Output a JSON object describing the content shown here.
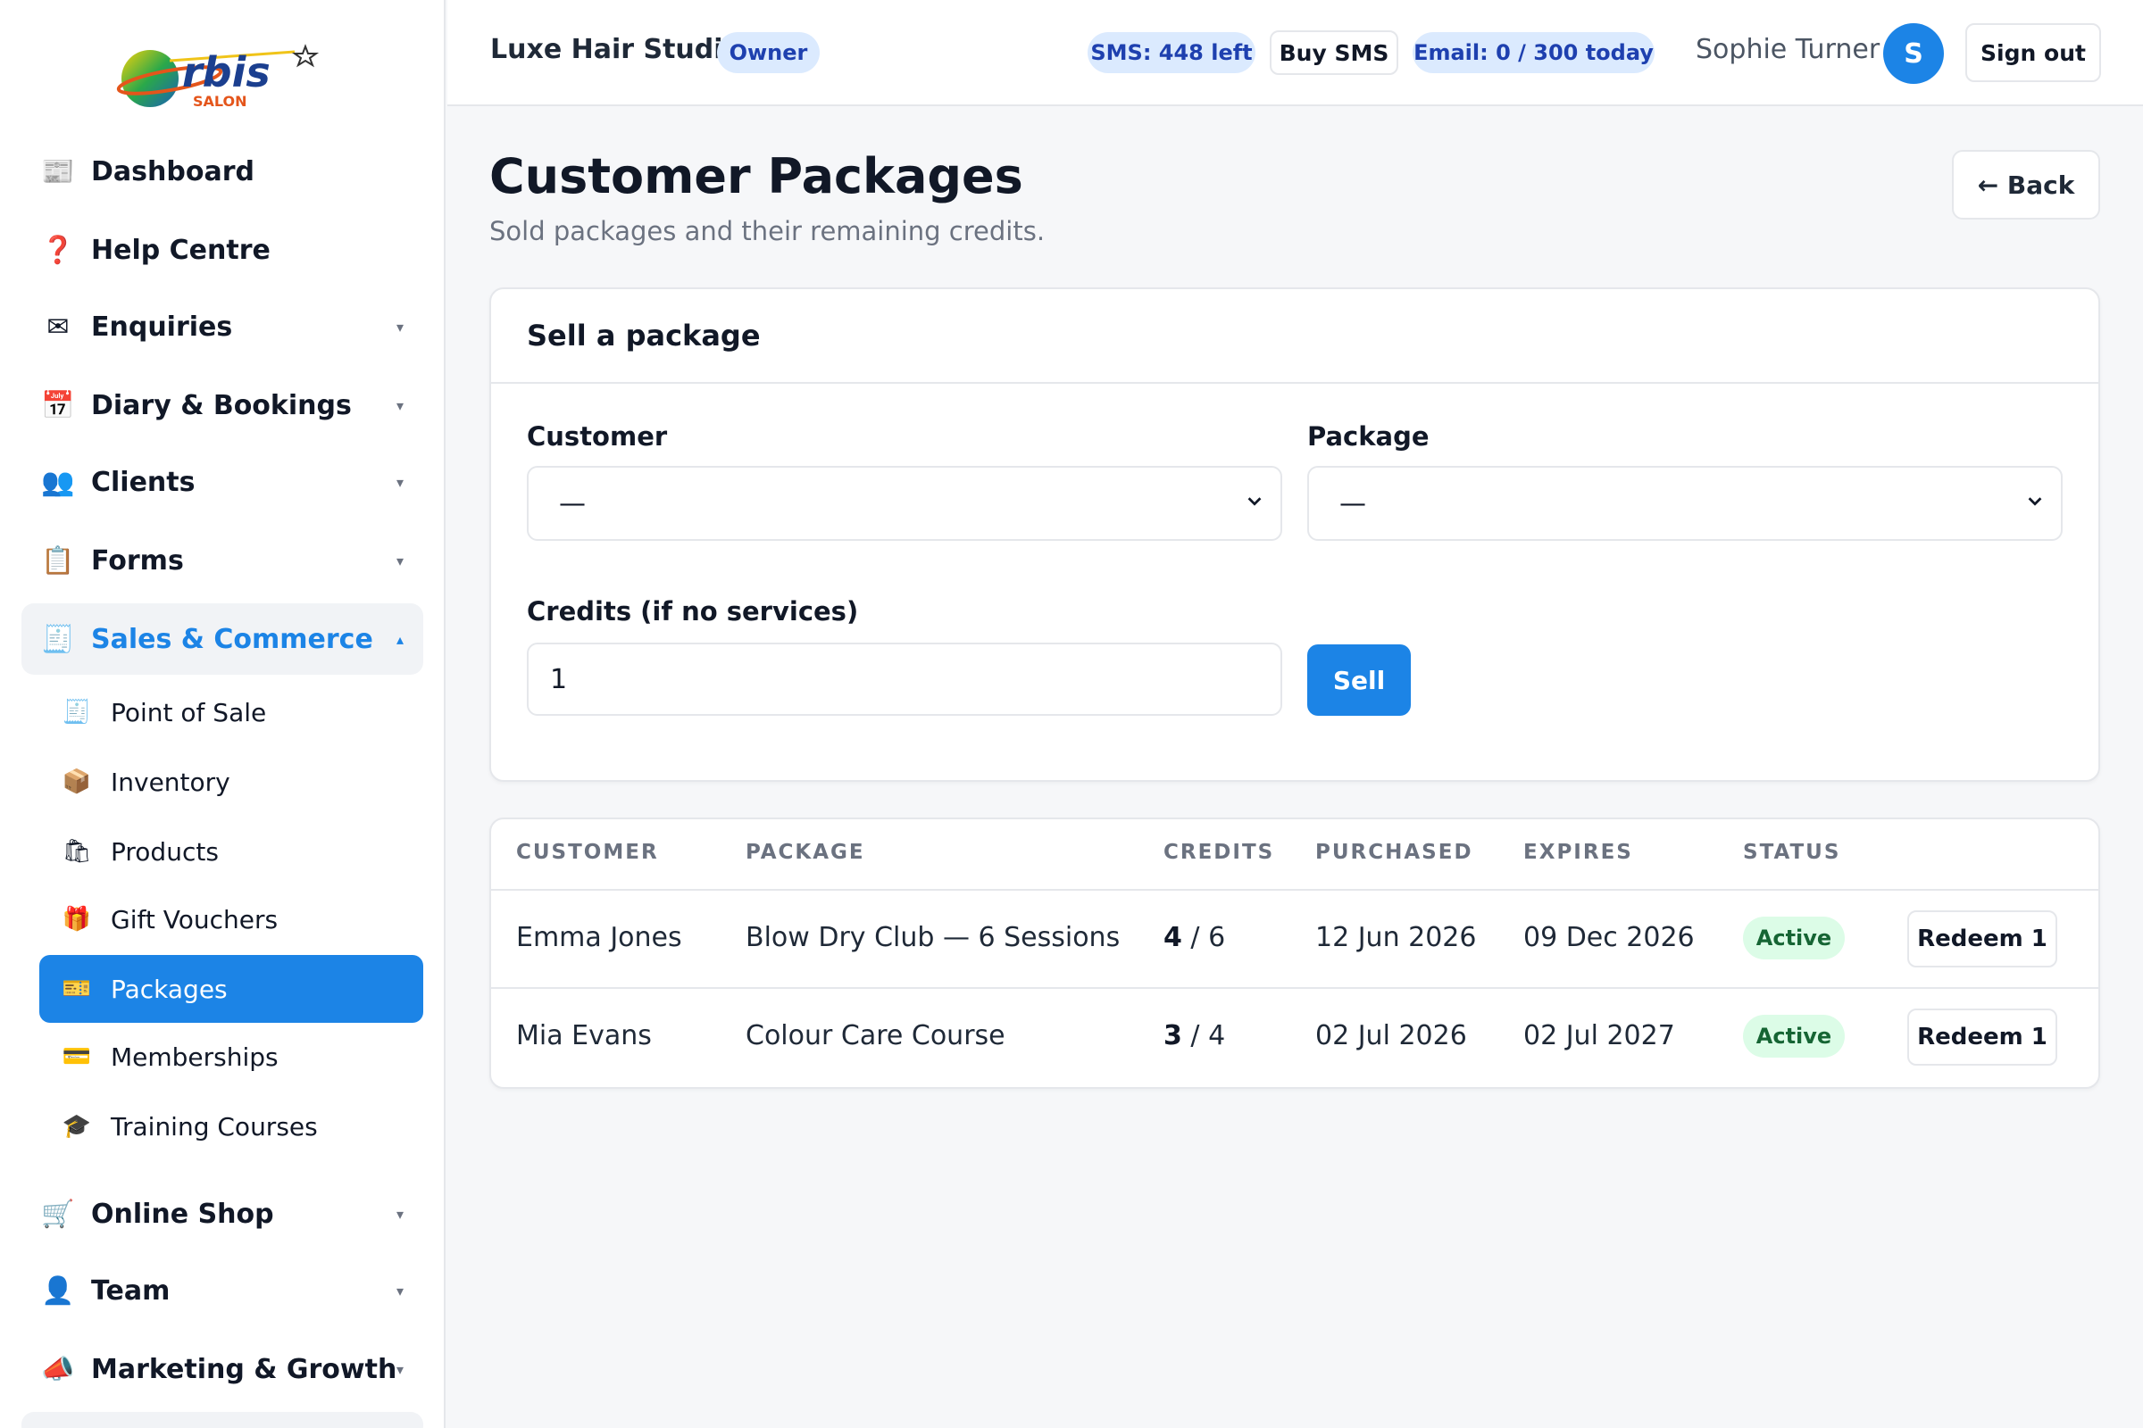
{
  "logo": {
    "wordmark": "rbis",
    "sub": "SALON"
  },
  "sidebar": {
    "items": [
      {
        "label": "Dashboard",
        "icon": "📰"
      },
      {
        "label": "Help Centre",
        "icon": "❓"
      },
      {
        "label": "Enquiries",
        "icon": "✉"
      },
      {
        "label": "Diary & Bookings",
        "icon": "📅"
      },
      {
        "label": "Clients",
        "icon": "👥"
      },
      {
        "label": "Forms",
        "icon": "📋"
      },
      {
        "label": "Sales & Commerce",
        "icon": "🧾"
      },
      {
        "label": "Online Shop",
        "icon": "🛒"
      },
      {
        "label": "Team",
        "icon": "👤"
      },
      {
        "label": "Marketing & Growth",
        "icon": "📣"
      }
    ],
    "sub_items": [
      {
        "label": "Point of Sale",
        "icon": "🧾"
      },
      {
        "label": "Inventory",
        "icon": "📦"
      },
      {
        "label": "Products",
        "icon": "🛍"
      },
      {
        "label": "Gift Vouchers",
        "icon": "🎁"
      },
      {
        "label": "Packages",
        "icon": "🎫"
      },
      {
        "label": "Memberships",
        "icon": "💳"
      },
      {
        "label": "Training Courses",
        "icon": "🎓"
      }
    ],
    "caret_down": "▾",
    "caret_up": "▴"
  },
  "header": {
    "studio": "Luxe Hair Studio",
    "role": "Owner",
    "sms": "SMS: 448 left",
    "buy_sms": "Buy SMS",
    "email": "Email: 0 / 300 today",
    "user": "Sophie Turner",
    "avatar": "S",
    "sign_out": "Sign out"
  },
  "page": {
    "title": "Customer Packages",
    "subtitle": "Sold packages and their remaining credits.",
    "back": "← Back"
  },
  "sell_form": {
    "title": "Sell a package",
    "customer_label": "Customer",
    "customer_value": "—",
    "package_label": "Package",
    "package_value": "—",
    "credits_label": "Credits (if no services)",
    "credits_value": "1",
    "sell": "Sell"
  },
  "table": {
    "headers": [
      "CUSTOMER",
      "PACKAGE",
      "CREDITS",
      "PURCHASED",
      "EXPIRES",
      "STATUS"
    ],
    "rows": [
      {
        "customer": "Emma Jones",
        "package": "Blow Dry Club — 6 Sessions",
        "credits_left": "4",
        "credits_total": "/ 6",
        "purchased": "12 Jun 2026",
        "expires": "09 Dec 2026",
        "status": "Active",
        "action": "Redeem 1"
      },
      {
        "customer": "Mia Evans",
        "package": "Colour Care Course",
        "credits_left": "3",
        "credits_total": "/ 4",
        "purchased": "02 Jul 2026",
        "expires": "02 Jul 2027",
        "status": "Active",
        "action": "Redeem 1"
      }
    ]
  },
  "colors": {
    "accent": "#1c84e6",
    "active_badge_bg": "#dcfce7",
    "active_badge_text": "#166534",
    "pill_bg": "#dbeafe"
  }
}
